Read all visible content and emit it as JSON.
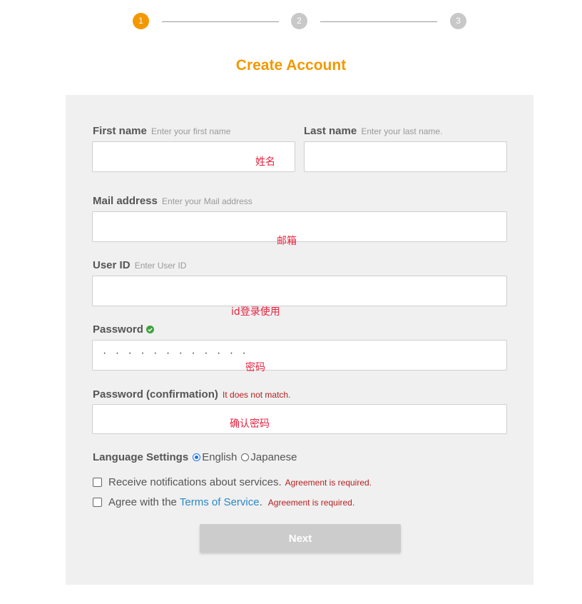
{
  "stepper": {
    "steps": [
      "1",
      "2",
      "3"
    ],
    "active_step": 1
  },
  "title": "Create Account",
  "form": {
    "first_name": {
      "label": "First name",
      "hint": "Enter your first name",
      "value": ""
    },
    "last_name": {
      "label": "Last name",
      "hint": "Enter your last name.",
      "value": ""
    },
    "mail": {
      "label": "Mail address",
      "hint": "Enter your Mail address",
      "value": ""
    },
    "user_id": {
      "label": "User ID",
      "hint": "Enter User ID",
      "value": ""
    },
    "password": {
      "label": "Password",
      "check_icon": "check-circle-icon",
      "masked_value": "· · · · · · · · · · · ·"
    },
    "password_confirm": {
      "label": "Password (confirmation)",
      "error": "It does not match.",
      "value": ""
    },
    "language": {
      "label": "Language Settings",
      "options": [
        {
          "label": "English",
          "selected": true
        },
        {
          "label": "Japanese",
          "selected": false
        }
      ]
    },
    "notifications": {
      "label": "Receive notifications about services.",
      "error": "Agreement is required.",
      "checked": false
    },
    "terms": {
      "prefix": "Agree with the",
      "link": "Terms of Service",
      "suffix": ".",
      "error": "Agreement is required.",
      "checked": false
    },
    "next_button": "Next"
  },
  "annotations": {
    "first_name": "姓名",
    "mail": "邮箱",
    "user_id": "id登录使用",
    "password": "密码",
    "password_confirm": "确认密码"
  },
  "colors": {
    "accent": "#f39800",
    "error": "#b52020",
    "link": "#2a88c8",
    "annotation": "#e8223f",
    "panel": "#f0f0f0"
  }
}
